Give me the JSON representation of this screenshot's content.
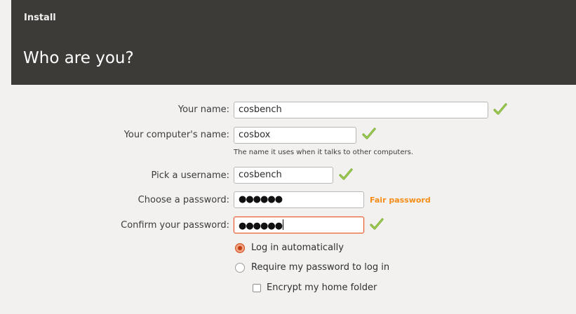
{
  "header": {
    "window_title": "Install",
    "page_title": "Who are you?"
  },
  "form": {
    "your_name": {
      "label": "Your name:",
      "value": "cosbench",
      "status_icon": "green-check-icon"
    },
    "computer_name": {
      "label": "Your computer's name:",
      "value": "cosbox",
      "status_icon": "green-check-icon",
      "hint": "The name it uses when it talks to other computers."
    },
    "username": {
      "label": "Pick a username:",
      "value": "cosbench",
      "status_icon": "green-check-icon"
    },
    "password": {
      "label": "Choose a password:",
      "masked_value": "●●●●●●",
      "strength": "Fair password"
    },
    "confirm_password": {
      "label": "Confirm your password:",
      "masked_value": "●●●●●●",
      "status_icon": "green-check-icon"
    },
    "login_options": {
      "auto_login": {
        "label": "Log in automatically",
        "selected": true
      },
      "require_password": {
        "label": "Require my password to log in",
        "selected": false
      },
      "encrypt_home": {
        "label": "Encrypt my home folder",
        "checked": false
      }
    }
  },
  "colors": {
    "header_bg": "#3c3b37",
    "accent": "#e95420",
    "strength_warning": "#f48c16",
    "check_green": "#7bb02e"
  }
}
